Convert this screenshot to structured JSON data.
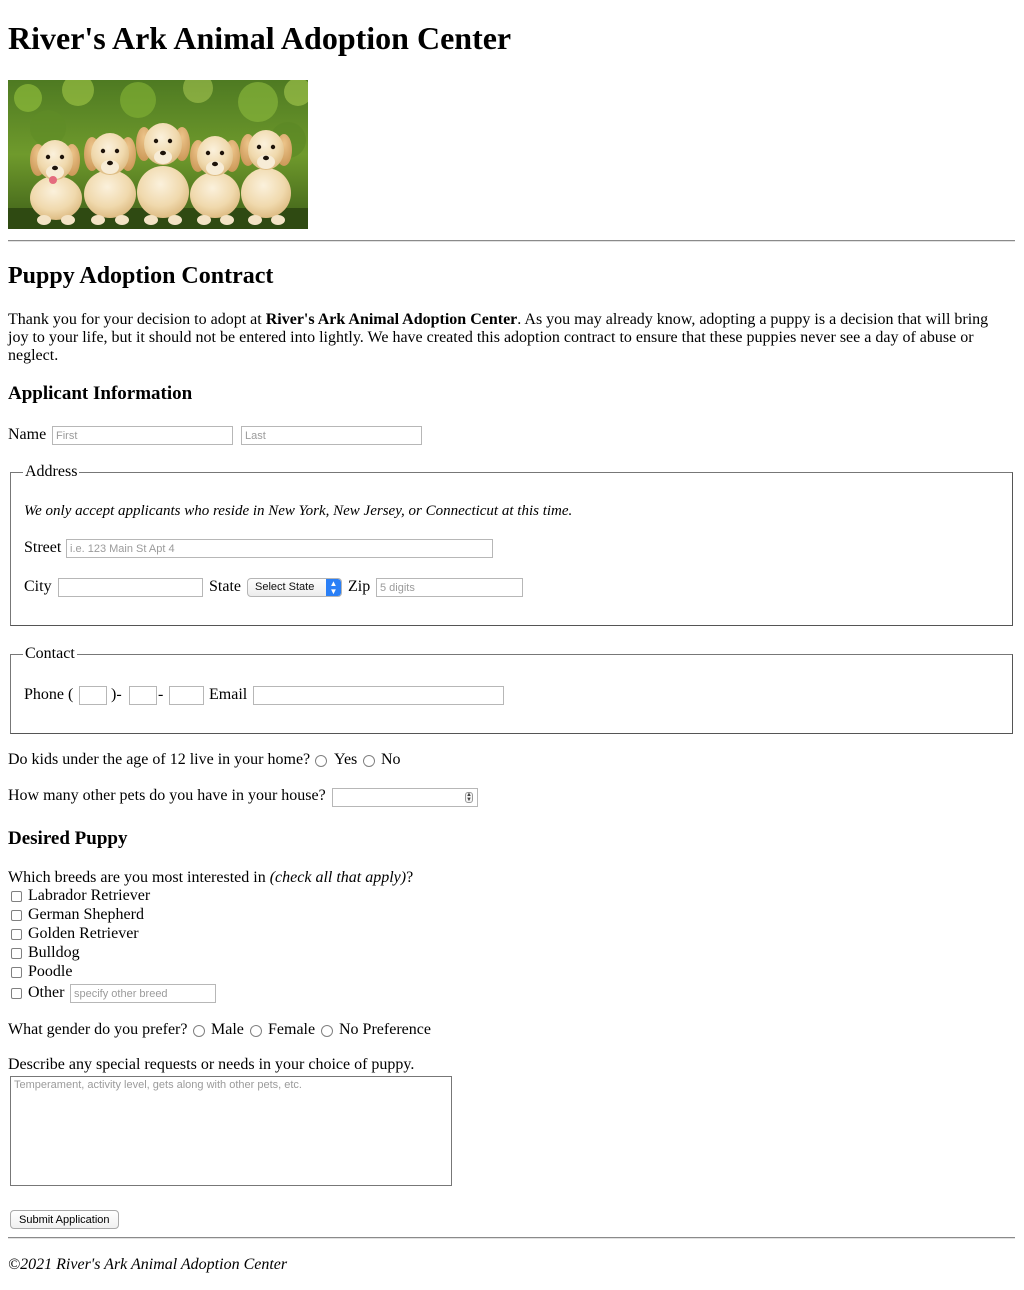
{
  "site_title": "River's Ark Animal Adoption Center",
  "hero_image_alt": "Five golden retriever puppies",
  "contract_title": "Puppy Adoption Contract",
  "intro": {
    "before": "Thank you for your decision to adopt at ",
    "bold": "River's Ark Animal Adoption Center",
    "after": ". As you may already know, adopting a puppy is a decision that will bring joy to your life, but it should not be entered into lightly. We have created this adoption contract to ensure that these puppies never see a day of abuse or neglect."
  },
  "applicant": {
    "heading": "Applicant Information",
    "name_label": "Name",
    "first_placeholder": "First",
    "last_placeholder": "Last",
    "first_value": "",
    "last_value": ""
  },
  "address": {
    "legend": "Address",
    "note": "We only accept applicants who reside in New York, New Jersey, or Connecticut at this time.",
    "street_label": "Street",
    "street_placeholder": "i.e. 123 Main St Apt 4",
    "city_label": "City",
    "state_label": "State",
    "state_selected": "Select State",
    "zip_label": "Zip",
    "zip_placeholder": "5 digits"
  },
  "contact": {
    "legend": "Contact",
    "phone_label": "Phone (",
    "phone_sep1": ")-",
    "phone_sep2": "-",
    "email_label": "Email"
  },
  "kids": {
    "question": "Do kids under the age of 12 live in your home?",
    "options": [
      "Yes",
      "No"
    ]
  },
  "pets": {
    "question": "How many other pets do you have in your house?",
    "value": ""
  },
  "desired": {
    "heading": "Desired Puppy",
    "breeds_question_start": "Which breeds are you most interested in ",
    "breeds_question_italic": "(check all that apply)",
    "breeds_question_end": "?",
    "breeds": [
      "Labrador Retriever",
      "German Shepherd",
      "Golden Retriever",
      "Bulldog",
      "Poodle",
      "Other"
    ],
    "other_placeholder": "specify other breed"
  },
  "gender": {
    "question": "What gender do you prefer?",
    "options": [
      "Male",
      "Female",
      "No Preference"
    ]
  },
  "requests": {
    "question": "Describe any special requests or needs in your choice of puppy.",
    "placeholder": "Temperament, activity level, gets along with other pets, etc."
  },
  "submit_label": "Submit Application",
  "footer": "©2021 River's Ark Animal Adoption Center",
  "colors": {
    "select_accent": "#2a7ff6",
    "rule": "#8a8a8a"
  }
}
